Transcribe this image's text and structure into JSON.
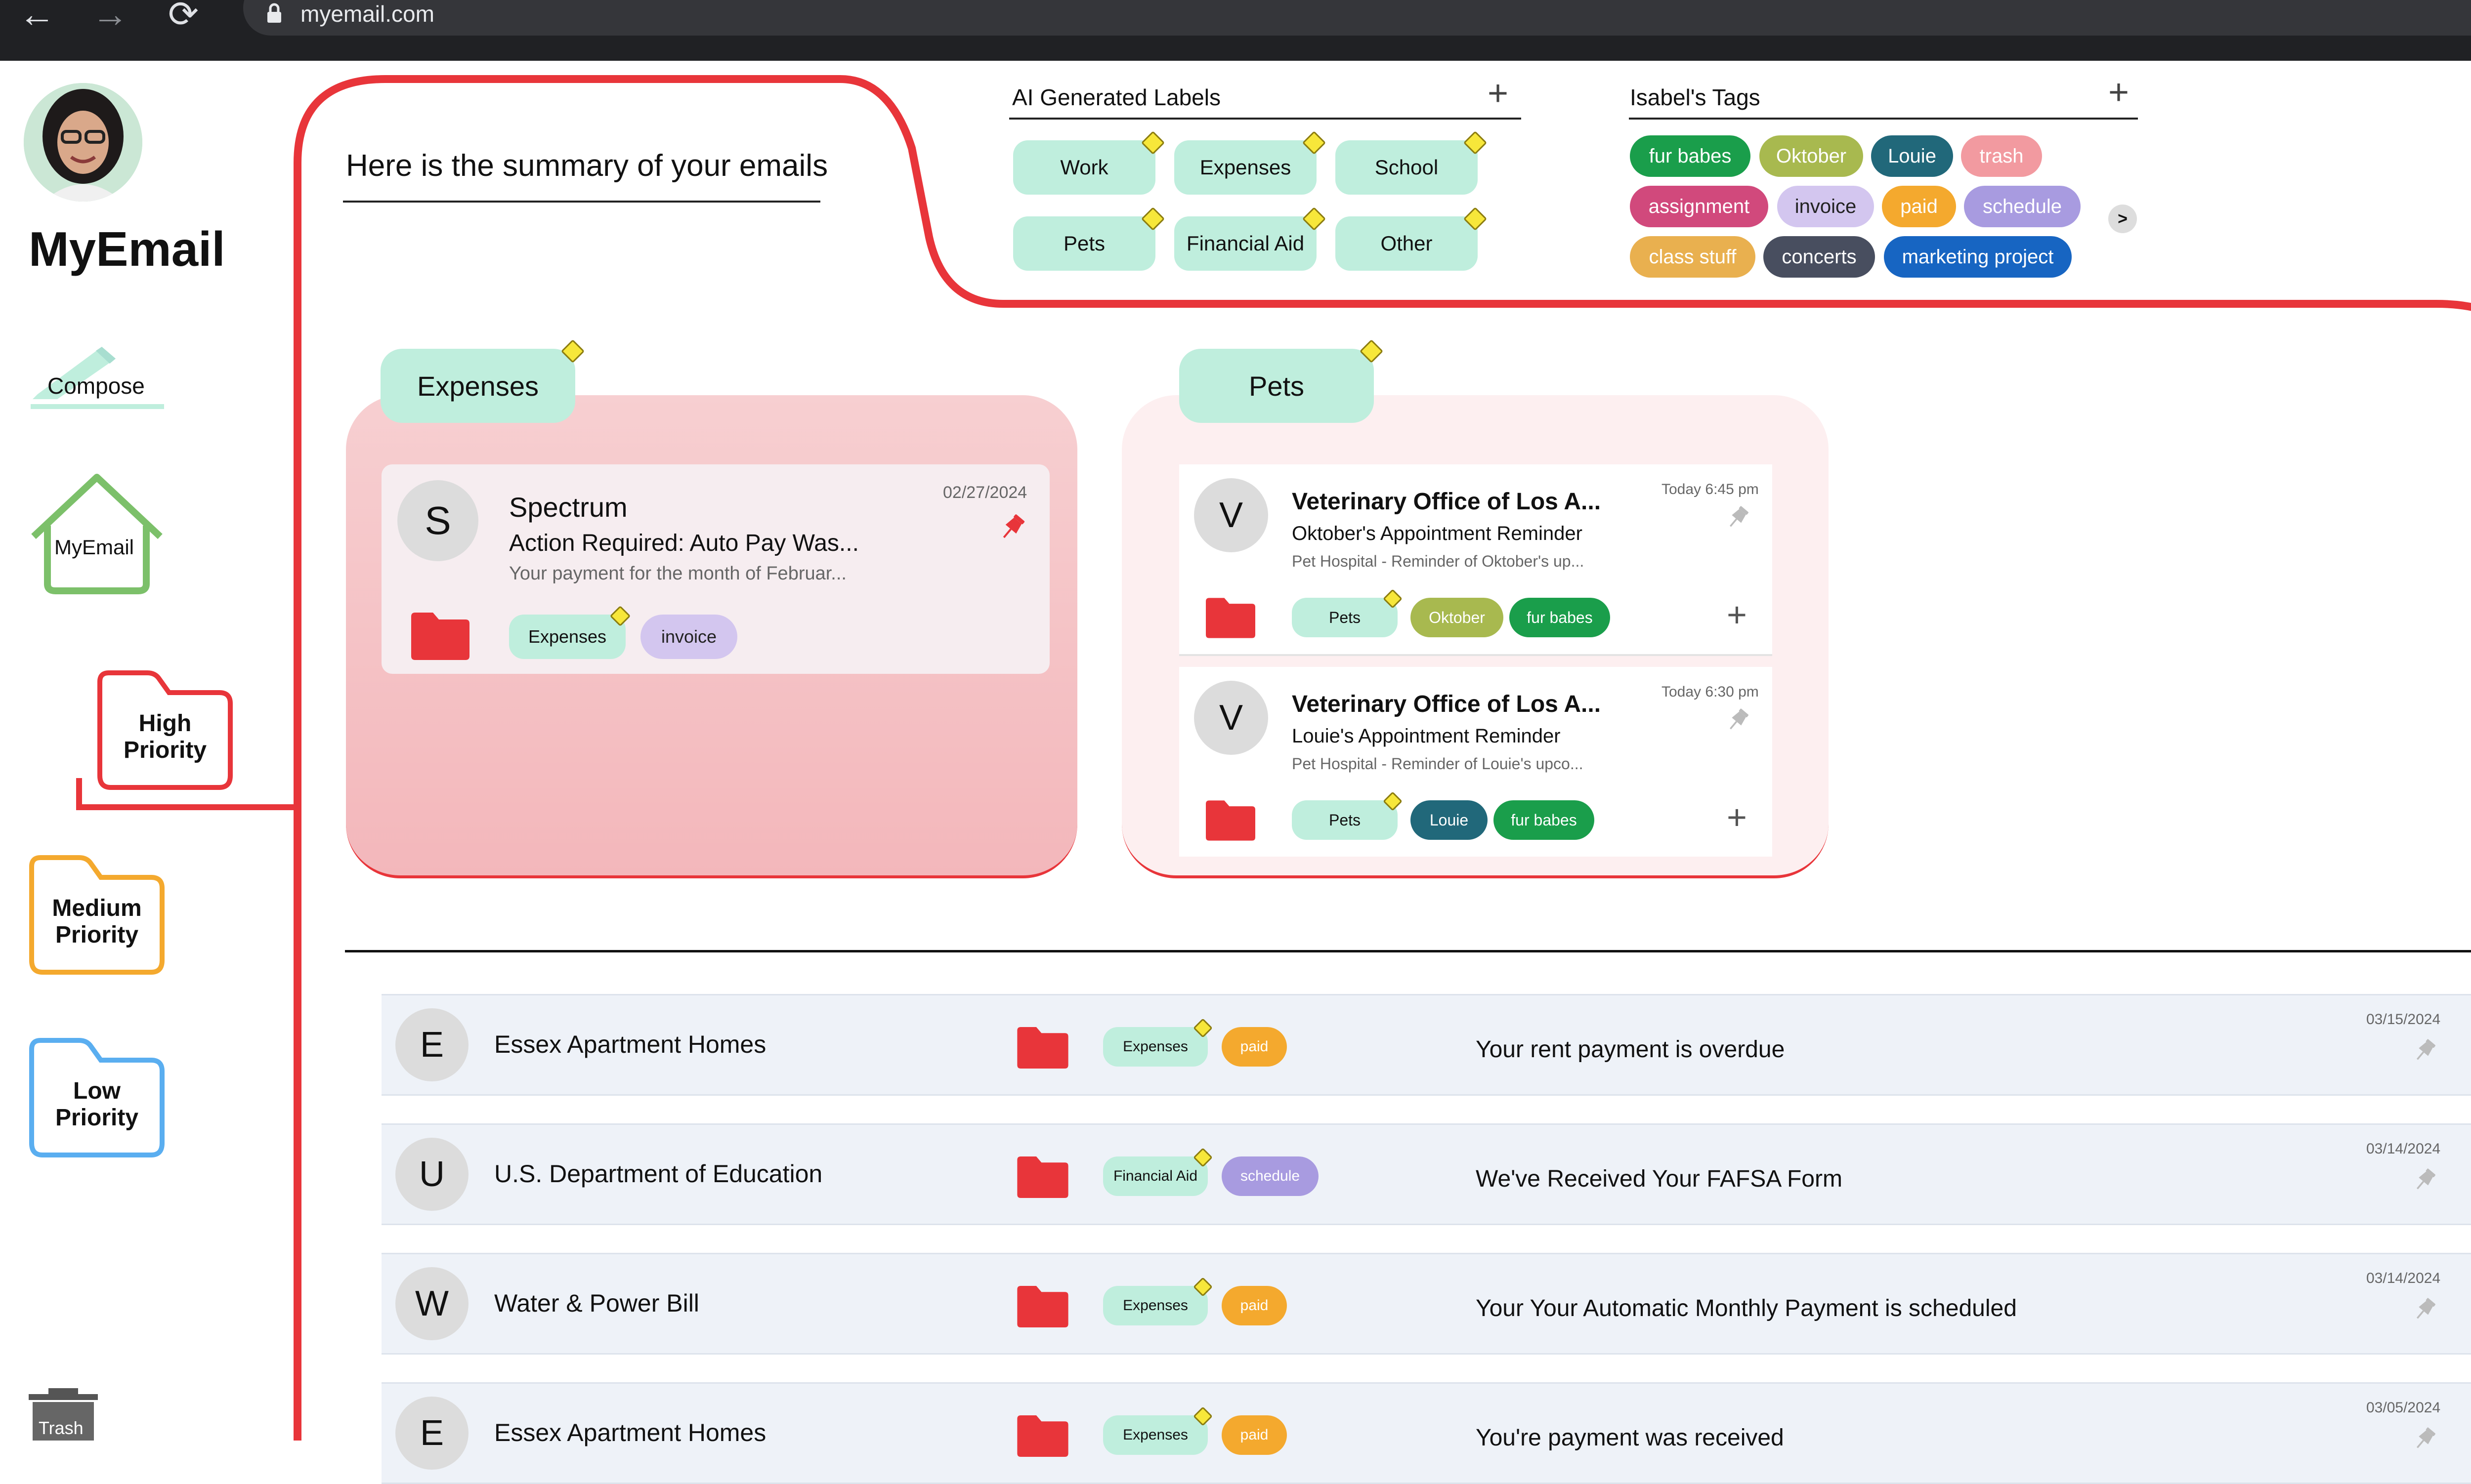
{
  "browser": {
    "url": "myemail.com",
    "back": "←",
    "forward": "→",
    "reload": "⟳"
  },
  "app": {
    "name": "MyEmail"
  },
  "sidebar": {
    "compose": "Compose",
    "home": "MyEmail",
    "high": "High\nPriority",
    "medium": "Medium\nPriority",
    "low": "Low\nPriority",
    "trash": "Trash"
  },
  "summary": {
    "title": "Here is the summary of your emails"
  },
  "ai_labels": {
    "title": "AI Generated Labels",
    "items": [
      "Work",
      "Expenses",
      "School",
      "Pets",
      "Financial Aid",
      "Other"
    ]
  },
  "tags": {
    "title": "Isabel's Tags",
    "items": [
      {
        "label": "fur babes",
        "color": "#1a9e4b"
      },
      {
        "label": "Oktober",
        "color": "#a8b94f"
      },
      {
        "label": "Louie",
        "color": "#21687a"
      },
      {
        "label": "trash",
        "color": "#f29aa0"
      },
      {
        "label": "assignment",
        "color": "#d1497c"
      },
      {
        "label": "invoice",
        "color": "#d3c6ef"
      },
      {
        "label": "paid",
        "color": "#f4a92e"
      },
      {
        "label": "schedule",
        "color": "#a89be0"
      },
      {
        "label": "class stuff",
        "color": "#e9b04f"
      },
      {
        "label": "concerts",
        "color": "#484e5f"
      },
      {
        "label": "marketing project",
        "color": "#1765c2"
      }
    ],
    "more": ">"
  },
  "expenses_card": {
    "title": "Expenses",
    "email": {
      "initial": "S",
      "sender": "Spectrum",
      "subject": "Action Required: Auto Pay Was...",
      "preview": "Your payment for the month of Februar...",
      "date": "02/27/2024",
      "labels": [
        "Expenses",
        "invoice"
      ]
    }
  },
  "pets_card": {
    "title": "Pets",
    "emails": [
      {
        "initial": "V",
        "sender": "Veterinary Office of Los A...",
        "subject": "Oktober's Appointment Reminder",
        "preview": "Pet Hospital - Reminder of Oktober's up...",
        "date": "Today 6:45 pm",
        "labels": [
          "Pets",
          "Oktober",
          "fur babes"
        ]
      },
      {
        "initial": "V",
        "sender": "Veterinary Office of Los A...",
        "subject": "Louie's Appointment Reminder",
        "preview": "Pet Hospital - Reminder of Louie's upco...",
        "date": "Today 6:30 pm",
        "labels": [
          "Pets",
          "Louie",
          "fur babes"
        ]
      }
    ]
  },
  "email_list": [
    {
      "initial": "E",
      "sender": "Essex Apartment Homes",
      "label": "Expenses",
      "tag": "paid",
      "subject": "Your rent payment is overdue",
      "date": "03/15/2024"
    },
    {
      "initial": "U",
      "sender": "U.S. Department of Education",
      "label": "Financial Aid",
      "tag": "schedule",
      "subject": "We've Received Your FAFSA Form",
      "date": "03/14/2024"
    },
    {
      "initial": "W",
      "sender": "Water & Power Bill",
      "label": "Expenses",
      "tag": "paid",
      "subject": "Your Your Automatic Monthly Payment is scheduled",
      "date": "03/14/2024"
    },
    {
      "initial": "E",
      "sender": "Essex Apartment Homes",
      "label": "Expenses",
      "tag": "paid",
      "subject": "You're payment was received",
      "date": "03/05/2024"
    }
  ],
  "colors": {
    "accent_red": "#e8353a",
    "label_mint": "#bfeedd",
    "high": "#e8353a",
    "medium": "#f4a92e",
    "low": "#5aaef0",
    "home": "#7cc06a"
  }
}
